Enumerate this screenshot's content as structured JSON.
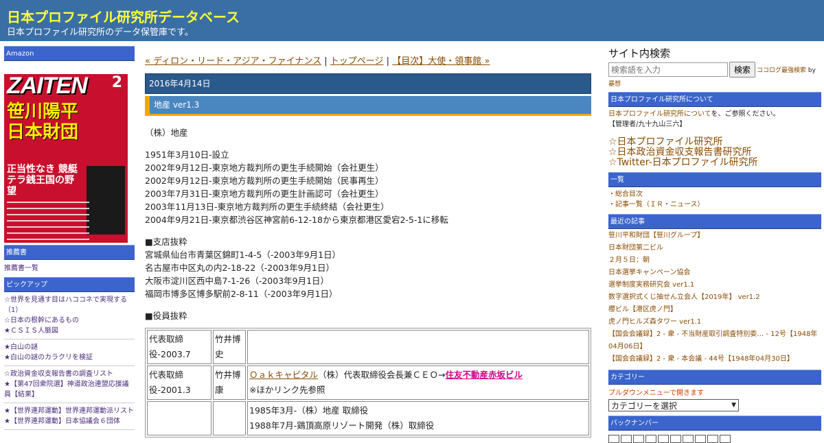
{
  "header": {
    "title": "日本プロファイル研究所データベース",
    "description": "日本プロファイル研究所のデータ保管庫です。"
  },
  "left": {
    "amazon_heading": "Amazon",
    "magazine": {
      "name": "ZAITEN",
      "issue": "2",
      "headline": "笹川陽平 日本財団",
      "subhead": "正当性なき 競艇テラ銭王国の野望"
    },
    "recommend_heading": "推薦書",
    "recommend_link": "推薦書一覧",
    "pickup_heading": "ピックアップ",
    "pickup_groups": [
      [
        "☆世界を見通す目はハココネで実現する（1）",
        "☆日本の根幹にあるもの",
        "★ＣＳＩＳ人脈図"
      ],
      [
        "★白山の謎",
        "★白山の謎のカラクリを検証"
      ],
      [
        "☆政治資金収支報告書の調査リスト",
        "★【第47回衆院選】神道政治連盟応援議員【結果】"
      ],
      [
        "★【世界連邦運動】世界連邦運動派リスト",
        "★【世界連邦運動】日本協議会６団体"
      ]
    ]
  },
  "main": {
    "nav": {
      "prev": "« ディロン・リード・アジア・ファイナンス",
      "sep1": " | ",
      "top": "トップページ",
      "sep2": " | ",
      "next": "【目次】大使・領事館 »"
    },
    "date": "2016年4月14日",
    "entry_title": "地産 ver1.3",
    "company": "（株）地産",
    "history": [
      "1951年3月10日-設立",
      "2002年9月12日-東京地方裁判所の更生手続開始（会社更生）",
      "2002年9月12日-東京地方裁判所の更生手続開始（民事再生）",
      "2003年7月31日-東京地方裁判所の更生計画認可（会社更生）",
      "2003年11月13日-東京地方裁判所の更生手続終結（会社更生）",
      "2004年9月21日-東京都渋谷区神宮前6-12-18から東京都港区愛宕2-5-1に移転"
    ],
    "branch_heading": "■支店抜粋",
    "branches": [
      "宮城県仙台市青葉区錦町1-4-5（-2003年9月1日）",
      "名古屋市中区丸の内2-18-22（-2003年9月1日）",
      "大阪市淀川区西中島7-1-26（-2003年9月1日）",
      "福岡市博多区博多駅前2-8-11（-2003年9月1日）"
    ],
    "officer_heading": "■役員抜粋",
    "officers": [
      {
        "role": "代表取締役-2003.7",
        "name": "竹井博史"
      },
      {
        "role": "代表取締役-2001.3",
        "name": "竹井博康",
        "link1": "Ｏａｋキャピタル",
        "text1": "（株）代表取締役会長兼ＣＥＯ→",
        "link2": "住友不動産赤坂ビル",
        "note": "※ほかリンク先参照"
      },
      {
        "line1": "1985年3月-（株）地産 取締役",
        "line2": "1988年7月-鶏頂高原リゾート開発（株）取締役"
      }
    ]
  },
  "right": {
    "search_heading": "サイト内検索",
    "search_placeholder": "検索語を入力",
    "search_button": "検索",
    "cocolog_link": "ココログ最強検索",
    "cocolog_by": " by ",
    "cocolog_author": "暴想",
    "about_heading": "日本プロファイル研究所について",
    "about_link": "日本プロファイル研究所について",
    "about_text": "を、ご参照ください。",
    "admin": "【管理者/九十九山三六】",
    "big_links": [
      "☆日本プロファイル研究所",
      "☆日本政治資金収支報告書研究所",
      "☆Twitter-日本プロファイル研究所"
    ],
    "list_heading": "一覧",
    "list_links": [
      "・総合目次",
      "・記事一覧（ＩＲ・ニュース）"
    ],
    "recent_heading": "最近の記事",
    "recent": [
      "笹川平和財団【笹川グループ】",
      "日本財団第二ビル",
      "２月５日：朝",
      "日本選挙キャンペーン協会",
      "選挙制度実務研究会 ver1.1",
      "数字選択式くじ抽せん立会人【2019年】 ver1.2",
      "櫻ビル【港区虎ノ門】",
      "虎ノ門ヒルズ森タワー ver1.1",
      "【国会会議録】2 - 衆 - 不当財産取引調査特別委… - 12号【1948年04月06日】",
      "【国会会議録】2 - 衆 - 本会議 - 44号【1948年04月30日】"
    ],
    "category_heading": "カテゴリー",
    "category_note": "プルダウンメニューで開きます",
    "category_select": "カテゴリーを選択",
    "backnumber_heading": "バックナンバー"
  },
  "colors": {
    "header_bg": "#3a6fa6",
    "title_yellow": "#ffff33",
    "sidebar_heading": "#3b64cc",
    "accent_orange": "#f7a600",
    "link_brown": "#8a4a00"
  }
}
